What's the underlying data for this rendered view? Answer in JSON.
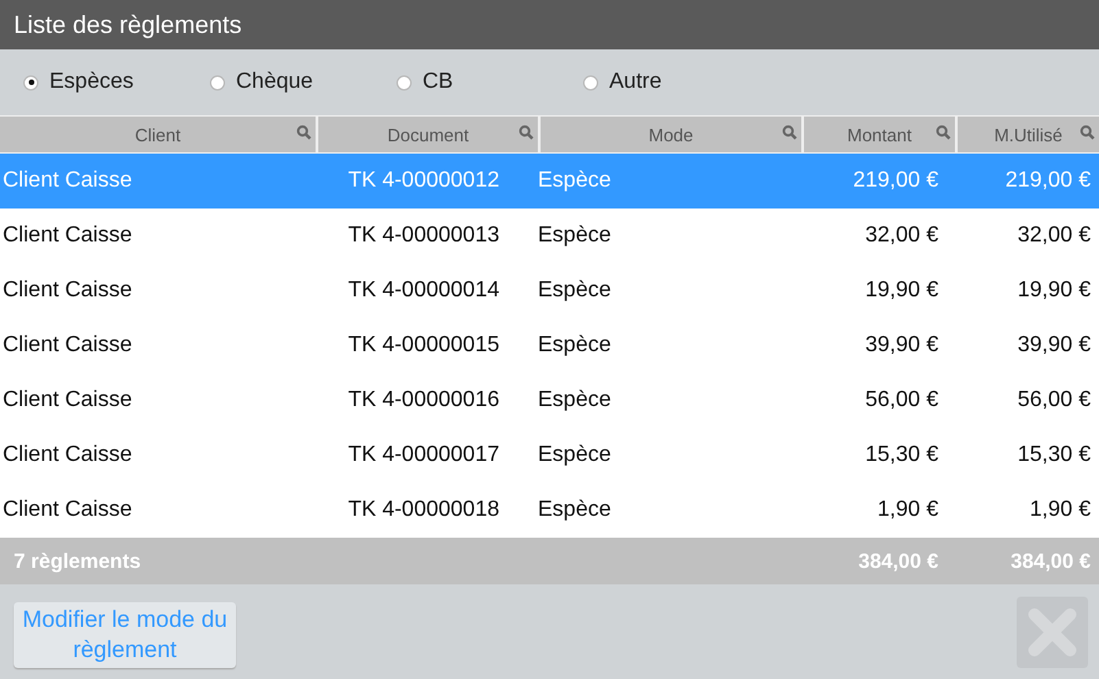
{
  "window": {
    "title": "Liste des règlements"
  },
  "payment_modes": [
    {
      "label": "Espèces",
      "selected": true
    },
    {
      "label": "Chèque",
      "selected": false
    },
    {
      "label": "CB",
      "selected": false
    },
    {
      "label": "Autre",
      "selected": false
    }
  ],
  "table": {
    "columns": [
      "Client",
      "Document",
      "Mode",
      "Montant",
      "M.Utilisé"
    ],
    "rows": [
      {
        "cells": [
          "Client Caisse",
          "TK 4-00000012",
          "Espèce",
          "219,00 €",
          "219,00 €"
        ],
        "selected": true
      },
      {
        "cells": [
          "Client Caisse",
          "TK 4-00000013",
          "Espèce",
          "32,00 €",
          "32,00 €"
        ],
        "selected": false
      },
      {
        "cells": [
          "Client Caisse",
          "TK 4-00000014",
          "Espèce",
          "19,90 €",
          "19,90 €"
        ],
        "selected": false
      },
      {
        "cells": [
          "Client Caisse",
          "TK 4-00000015",
          "Espèce",
          "39,90 €",
          "39,90 €"
        ],
        "selected": false
      },
      {
        "cells": [
          "Client Caisse",
          "TK 4-00000016",
          "Espèce",
          "56,00 €",
          "56,00 €"
        ],
        "selected": false
      },
      {
        "cells": [
          "Client Caisse",
          "TK 4-00000017",
          "Espèce",
          "15,30 €",
          "15,30 €"
        ],
        "selected": false
      },
      {
        "cells": [
          "Client Caisse",
          "TK 4-00000018",
          "Espèce",
          "1,90 €",
          "1,90 €"
        ],
        "selected": false
      }
    ],
    "footer": {
      "count": "7 règlements",
      "montant_total": "384,00 €",
      "utilise_total": "384,00 €"
    }
  },
  "buttons": {
    "modify": "Modifier le mode du règlement",
    "close_disabled": true
  }
}
